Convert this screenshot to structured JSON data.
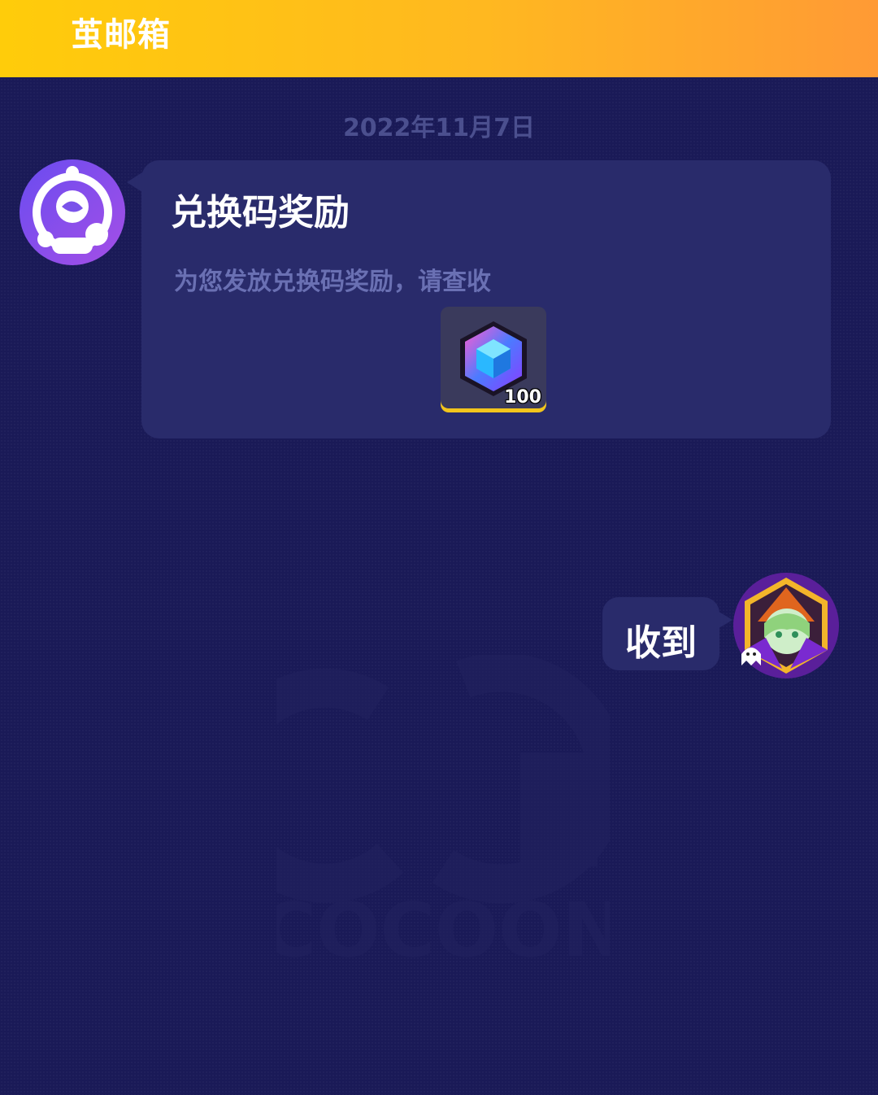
{
  "header": {
    "title": "茧邮箱"
  },
  "chat": {
    "date": "2022年11月7日",
    "message": {
      "title": "兑换码奖励",
      "body": "为您发放兑换码奖励，请查收",
      "attachment": {
        "icon": "gem-cube-icon",
        "quantity": "100"
      }
    },
    "reply": {
      "text": "收到"
    }
  },
  "watermark": {
    "text": "COCOON"
  },
  "colors": {
    "header_gradient_start": "#ffcc0a",
    "header_gradient_end": "#ff9a35",
    "background": "#1a1a57",
    "bubble": "#292b6b",
    "muted_text": "#6a70b3",
    "item_border": "#f2c51c"
  }
}
